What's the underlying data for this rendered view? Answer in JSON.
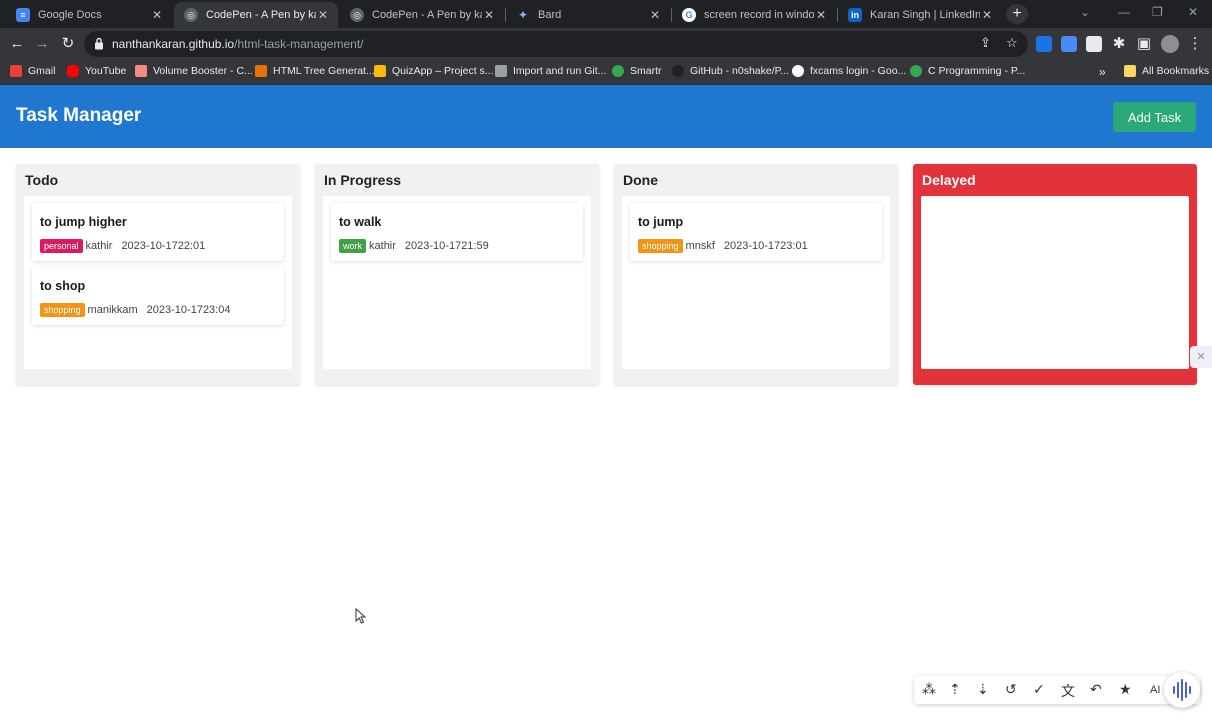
{
  "browser": {
    "tabs": [
      {
        "title": "Google Docs",
        "icon": "google-docs-icon",
        "icon_color": "#4285f4",
        "active": false
      },
      {
        "title": "CodePen - A Pen by karan",
        "icon": "codepen-icon",
        "icon_color": "#9aa0a6",
        "active": true
      },
      {
        "title": "CodePen - A Pen by karan",
        "icon": "codepen-icon",
        "icon_color": "#9aa0a6",
        "active": false
      },
      {
        "title": "Bard",
        "icon": "bard-icon",
        "icon_color": "#8ab4f8",
        "active": false
      },
      {
        "title": "screen record in windows",
        "icon": "google-icon",
        "icon_color": "#ffffff",
        "active": false
      },
      {
        "title": "Karan Singh | LinkedIn",
        "icon": "linkedin-icon",
        "icon_color": "#0a66c2",
        "active": false
      }
    ],
    "address": {
      "domain": "nanthankaran.github.io",
      "path": "/html-task-management/"
    },
    "bookmarks": [
      {
        "label": "Gmail",
        "color": "#ea4335"
      },
      {
        "label": "YouTube",
        "color": "#ff0000"
      },
      {
        "label": "Volume Booster - C...",
        "color": "#f28b82"
      },
      {
        "label": "HTML Tree Generat...",
        "color": "#e8710a"
      },
      {
        "label": "QuizApp – Project s...",
        "color": "#fbbc04"
      },
      {
        "label": "Import and run Git...",
        "color": "#9aa0a6"
      },
      {
        "label": "Smartr",
        "color": "#34a853"
      },
      {
        "label": "GitHub - n0shake/P...",
        "color": "#202124"
      },
      {
        "label": "fxcams login - Goo...",
        "color": "#ffffff"
      },
      {
        "label": "C Programming - P...",
        "color": "#34a853"
      }
    ],
    "bookmarks_overflow": "»",
    "all_bookmarks": "All Bookmarks"
  },
  "app": {
    "title": "Task Manager",
    "add_task_label": "Add Task",
    "colors": {
      "header": "#1f77d0",
      "add_button": "#2aa87a",
      "delayed": "#e2333a"
    },
    "columns": [
      {
        "title": "Todo",
        "cards": [
          {
            "title": "to jump higher",
            "tag": "personal",
            "user": "kathir",
            "timestamp": "2023-10-1722:01"
          },
          {
            "title": "to shop",
            "tag": "shopping",
            "user": "manikkam",
            "timestamp": "2023-10-1723:04"
          }
        ]
      },
      {
        "title": "In Progress",
        "cards": [
          {
            "title": "to walk",
            "tag": "work",
            "user": "kathir",
            "timestamp": "2023-10-1721:59"
          }
        ]
      },
      {
        "title": "Done",
        "cards": [
          {
            "title": "to jump",
            "tag": "shopping",
            "user": "mnskf",
            "timestamp": "2023-10-1723:01"
          }
        ]
      },
      {
        "title": "Delayed",
        "cards": []
      }
    ]
  },
  "float_toolbar": {
    "ai_label": "AI"
  }
}
